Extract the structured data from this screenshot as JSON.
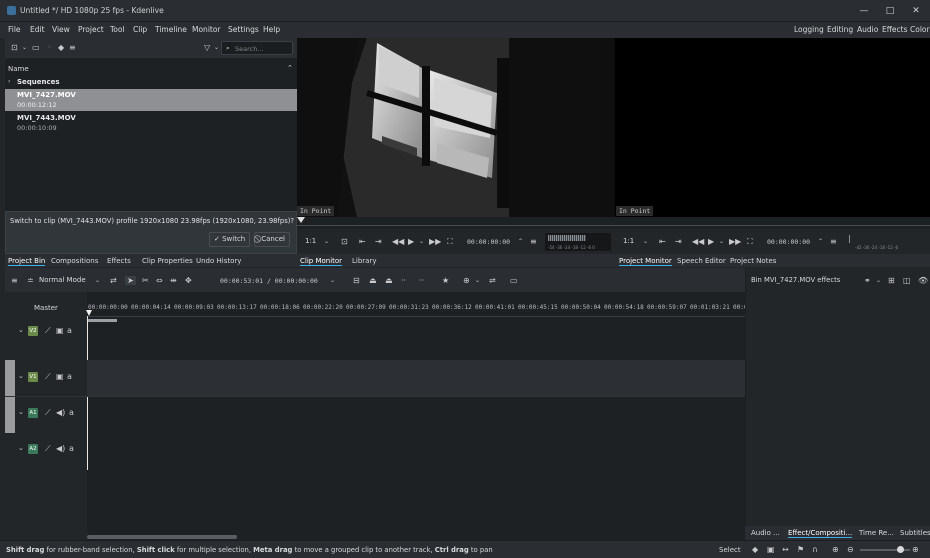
{
  "window": {
    "title": "Untitled */ HD 1080p 25 fps - Kdenlive",
    "minimize": "—",
    "maximize": "□",
    "close": "✕"
  },
  "menu": [
    "File",
    "Edit",
    "View",
    "Project",
    "Tool",
    "Clip",
    "Timeline",
    "Monitor",
    "Settings",
    "Help"
  ],
  "layouts": [
    "Logging",
    "Editing",
    "Audio",
    "Effects",
    "Color"
  ],
  "bin": {
    "search_placeholder": "Search...",
    "column_name": "Name",
    "folder": "Sequences",
    "clips": [
      {
        "name": "MVI_7427.MOV",
        "duration": "00:00:12:12",
        "selected": true
      },
      {
        "name": "MVI_7443.MOV",
        "duration": "00:00:10:09",
        "selected": false
      }
    ],
    "message": "Switch to clip (MVI_7443.MOV) profile 1920x1080 23.98fps (1920x1080, 23.98fps)?",
    "switch_label": "✓ Switch",
    "cancel_label": "⃠ Cancel"
  },
  "left_tabs": [
    "Project Bin",
    "Compositions",
    "Effects",
    "Clip Properties",
    "Undo History"
  ],
  "clip_monitor": {
    "in_point": "In Point",
    "zoom": "1:1",
    "timecode": "00:00:00:00",
    "tabs": [
      "Clip Monitor",
      "Library"
    ],
    "meter_labels": "-54 -36 -24 -18 -12 -6 0"
  },
  "project_monitor": {
    "in_point": "In Point",
    "zoom": "1:1",
    "timecode": "00:00:00:00",
    "tabs": [
      "Project Monitor",
      "Speech Editor",
      "Project Notes"
    ],
    "meter_labels": "-42 -30 -24 -18 -12 -6"
  },
  "timeline": {
    "mode": "Normal Mode",
    "timecode": "00:00:53:01 / 00:00:00:00",
    "master_label": "Master",
    "ruler": [
      "00:00:00:00",
      "00:00:04:14",
      "00:00:09:03",
      "00:00:13:17",
      "00:00:18:06",
      "00:00:22:20",
      "00:00:27:09",
      "00:00:31:23",
      "00:00:36:12",
      "00:00:41:01",
      "00:00:45:15",
      "00:00:50:04",
      "00:00:54:18",
      "00:00:59:07",
      "00:01:03:21",
      "00:0"
    ],
    "tracks": [
      {
        "id": "V2",
        "type": "video",
        "color": "#6a8a4a"
      },
      {
        "id": "V1",
        "type": "video",
        "color": "#6a8a4a"
      },
      {
        "id": "A1",
        "type": "audio",
        "color": "#3a7a5a"
      },
      {
        "id": "A2",
        "type": "audio",
        "color": "#3a7a5a"
      }
    ]
  },
  "effects_panel": {
    "title": "Bin MVI_7427.MOV effects",
    "tabs": [
      "Audio ...",
      "Effect/Compositi...",
      "Time Re...",
      "Subtitles"
    ]
  },
  "status": {
    "hint_parts": [
      {
        "text": "Shift drag",
        "bold": true
      },
      {
        "text": " for rubber-band selection, ",
        "bold": false
      },
      {
        "text": "Shift click",
        "bold": true
      },
      {
        "text": " for multiple selection, ",
        "bold": false
      },
      {
        "text": "Meta drag",
        "bold": true
      },
      {
        "text": " to move a grouped clip to another track, ",
        "bold": false
      },
      {
        "text": "Ctrl drag",
        "bold": true
      },
      {
        "text": " to pan",
        "bold": false
      }
    ],
    "tool": "Select"
  },
  "colors": {
    "accent": "#3daee9",
    "bg": "#232629",
    "panel": "#1e2124"
  }
}
